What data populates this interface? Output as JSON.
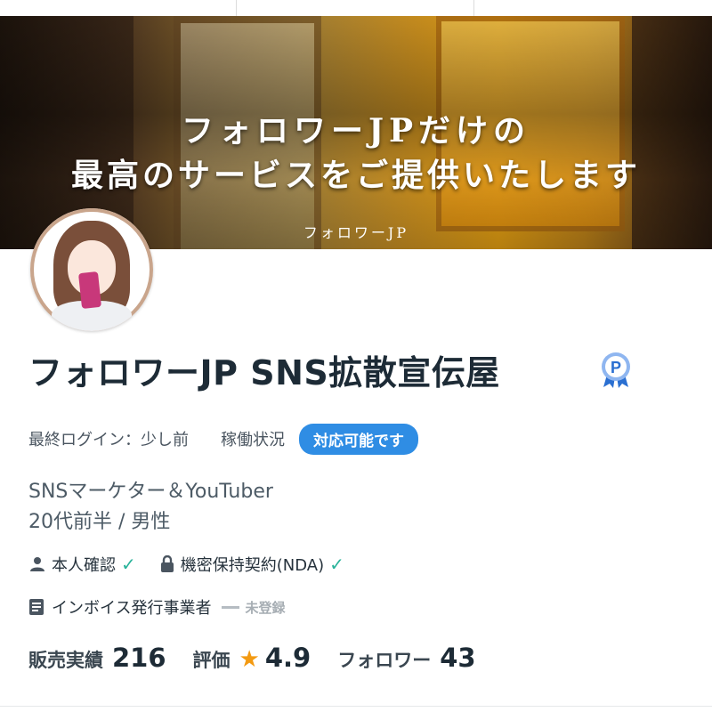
{
  "banner": {
    "line1": "フォロワーJPだけの",
    "line2": "最高のサービスをご提供いたします",
    "subtitle": "フォロワーJP"
  },
  "profile": {
    "name": "フォロワーJP SNS拡散宣伝屋",
    "badge_icon": "premium-p-badge-icon",
    "last_login": "最終ログイン：少し前",
    "availability_label": "稼働状況",
    "availability_status": "対応可能です",
    "bio_line1": "SNSマーケター＆YouTuber",
    "bio_line2": "20代前半 / 男性",
    "verifications": [
      {
        "icon": "person-icon",
        "label": "本人確認"
      },
      {
        "icon": "lock-icon",
        "label": "機密保持契約(NDA)"
      }
    ],
    "invoice": {
      "icon": "document-icon",
      "label": "インボイス発行事業者",
      "status": "未登録"
    },
    "stats": {
      "sales_label": "販売実績",
      "sales_value": "216",
      "rating_label": "評価",
      "rating_value": "4.9",
      "followers_label": "フォロワー",
      "followers_value": "43"
    }
  },
  "colors": {
    "accent": "#2f8de4",
    "check": "#29b39a",
    "star": "#f39a12",
    "text": "#1d2b36"
  }
}
